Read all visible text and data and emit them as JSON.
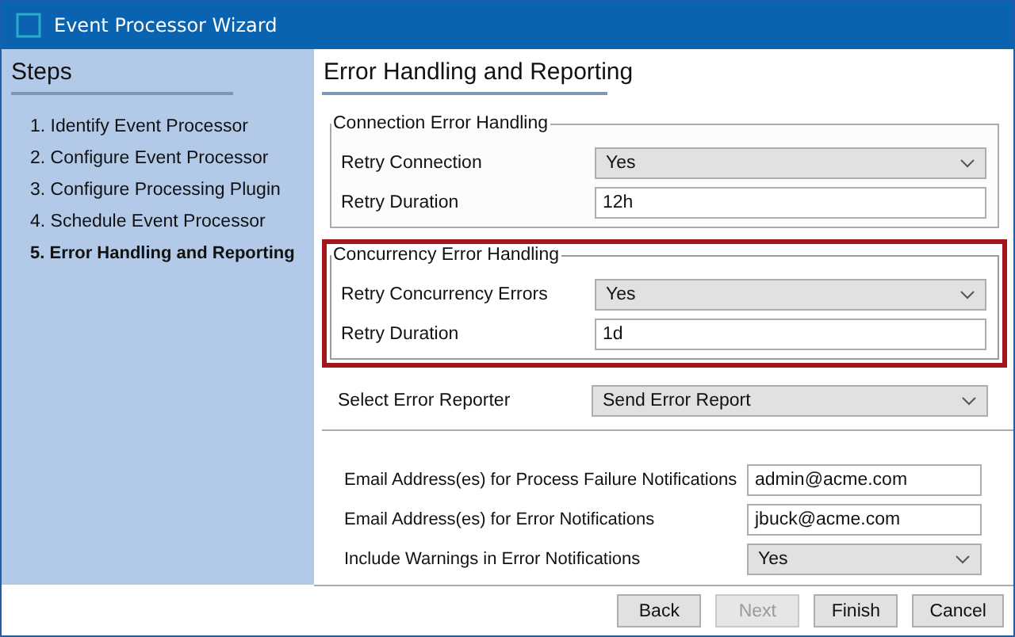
{
  "window": {
    "title": "Event Processor Wizard"
  },
  "sidebar": {
    "title": "Steps",
    "items": [
      {
        "label": "1. Identify Event Processor",
        "selected": false
      },
      {
        "label": "2. Configure Event Processor",
        "selected": false
      },
      {
        "label": "3. Configure Processing Plugin",
        "selected": false
      },
      {
        "label": "4. Schedule Event Processor",
        "selected": false
      },
      {
        "label": "5. Error Handling and Reporting",
        "selected": true
      }
    ]
  },
  "page": {
    "title": "Error Handling and Reporting"
  },
  "groups": [
    {
      "title": "Connection Error Handling",
      "highlighted": false,
      "fields": [
        {
          "kind": "select",
          "label": "Retry Connection",
          "value": "Yes"
        },
        {
          "kind": "text",
          "label": "Retry Duration",
          "value": "12h"
        }
      ]
    },
    {
      "title": "Concurrency Error Handling",
      "highlighted": true,
      "fields": [
        {
          "kind": "select",
          "label": "Retry Concurrency Errors",
          "value": "Yes"
        },
        {
          "kind": "text",
          "label": "Retry Duration",
          "value": "1d"
        }
      ]
    }
  ],
  "reporter": {
    "kind": "select",
    "label": "Select Error Reporter",
    "value": "Send Error Report"
  },
  "notifications": [
    {
      "kind": "text",
      "label": "Email Address(es) for Process Failure Notifications",
      "value": "admin@acme.com"
    },
    {
      "kind": "text",
      "label": "Email Address(es) for Error Notifications",
      "value": "jbuck@acme.com"
    },
    {
      "kind": "select",
      "label": "Include Warnings in Error Notifications",
      "value": "Yes"
    }
  ],
  "buttons": [
    {
      "label": "Back",
      "disabled": false
    },
    {
      "label": "Next",
      "disabled": true
    },
    {
      "label": "Finish",
      "disabled": false
    },
    {
      "label": "Cancel",
      "disabled": false
    }
  ]
}
